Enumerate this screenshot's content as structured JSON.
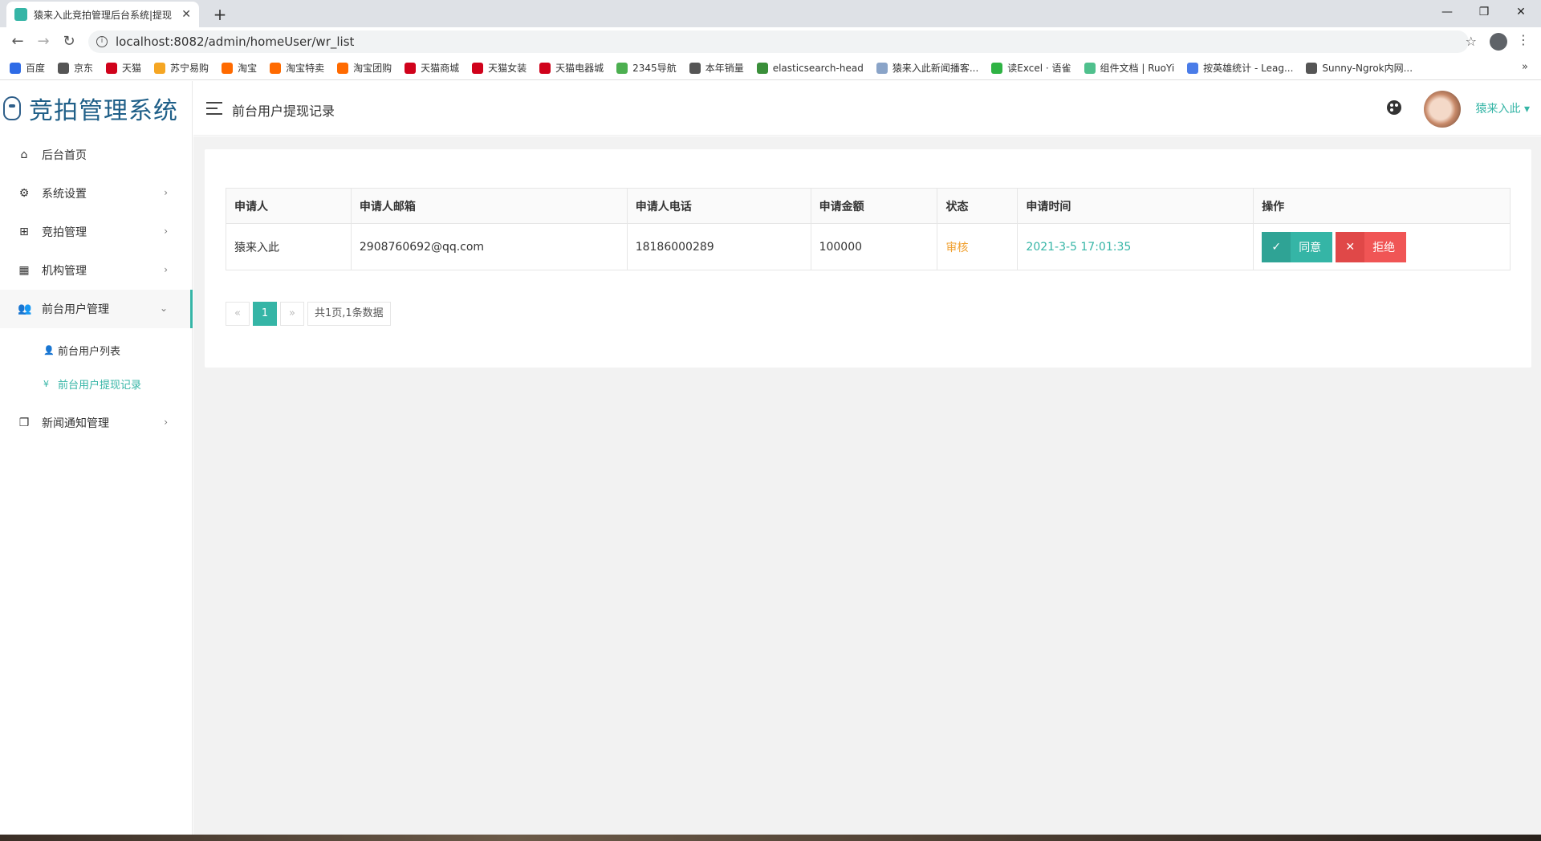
{
  "browser": {
    "tab_title": "猿来入此竞拍管理后台系统|提现",
    "url": "localhost:8082/admin/homeUser/wr_list",
    "bookmarks": [
      {
        "label": "百度",
        "color": "#2e6be6"
      },
      {
        "label": "京东",
        "color": "#555555"
      },
      {
        "label": "天猫",
        "color": "#d0021b"
      },
      {
        "label": "苏宁易购",
        "color": "#f5a623"
      },
      {
        "label": "淘宝",
        "color": "#ff6a00"
      },
      {
        "label": "淘宝特卖",
        "color": "#ff6a00"
      },
      {
        "label": "淘宝团购",
        "color": "#ff6a00"
      },
      {
        "label": "天猫商城",
        "color": "#d0021b"
      },
      {
        "label": "天猫女装",
        "color": "#d0021b"
      },
      {
        "label": "天猫电器城",
        "color": "#d0021b"
      },
      {
        "label": "2345导航",
        "color": "#4caf50"
      },
      {
        "label": "本年销量",
        "color": "#555555"
      },
      {
        "label": "elasticsearch-head",
        "color": "#3a8f3a"
      },
      {
        "label": "猿来入此新闻播客...",
        "color": "#8aa4c8"
      },
      {
        "label": "读Excel · 语雀",
        "color": "#2fb344"
      },
      {
        "label": "组件文档 | RuoYi",
        "color": "#4fc08d"
      },
      {
        "label": "按英雄统计 - Leag...",
        "color": "#4a7ce8"
      },
      {
        "label": "Sunny-Ngrok内网...",
        "color": "#555555"
      }
    ],
    "more": "»"
  },
  "sidebar": {
    "logo": "竞拍管理系统",
    "items": [
      {
        "label": "后台首页",
        "icon": "home-icon",
        "glyph": "⌂"
      },
      {
        "label": "系统设置",
        "icon": "gear-icon",
        "glyph": "⚙"
      },
      {
        "label": "竞拍管理",
        "icon": "sitemap-icon",
        "glyph": "⊞"
      },
      {
        "label": "机构管理",
        "icon": "dashboard-icon",
        "glyph": "▦"
      },
      {
        "label": "前台用户管理",
        "icon": "users-icon",
        "glyph": "👥"
      },
      {
        "label": "新闻通知管理",
        "icon": "copy-icon",
        "glyph": "❐"
      }
    ],
    "sub_items": [
      {
        "label": "前台用户列表",
        "icon": "user-icon",
        "glyph": "👤"
      },
      {
        "label": "前台用户提现记录",
        "icon": "yen-icon",
        "glyph": "¥"
      }
    ]
  },
  "header": {
    "title": "前台用户提现记录",
    "username": "猿来入此 ▾"
  },
  "table": {
    "columns": [
      "申请人",
      "申请人邮箱",
      "申请人电话",
      "申请金额",
      "状态",
      "申请时间",
      "操作"
    ],
    "rows": [
      {
        "applicant": "猿来入此",
        "email": "2908760692@qq.com",
        "phone": "18186000289",
        "amount": "100000",
        "status": "审核",
        "time": "2021-3-5 17:01:35",
        "agree_label": "同意",
        "reject_label": "拒绝"
      }
    ]
  },
  "pager": {
    "prev": "«",
    "current": "1",
    "next": "»",
    "info": "共1页,1条数据"
  },
  "colors": {
    "accent": "#35b5a6",
    "danger": "#f05555",
    "warning": "#f0a030"
  }
}
